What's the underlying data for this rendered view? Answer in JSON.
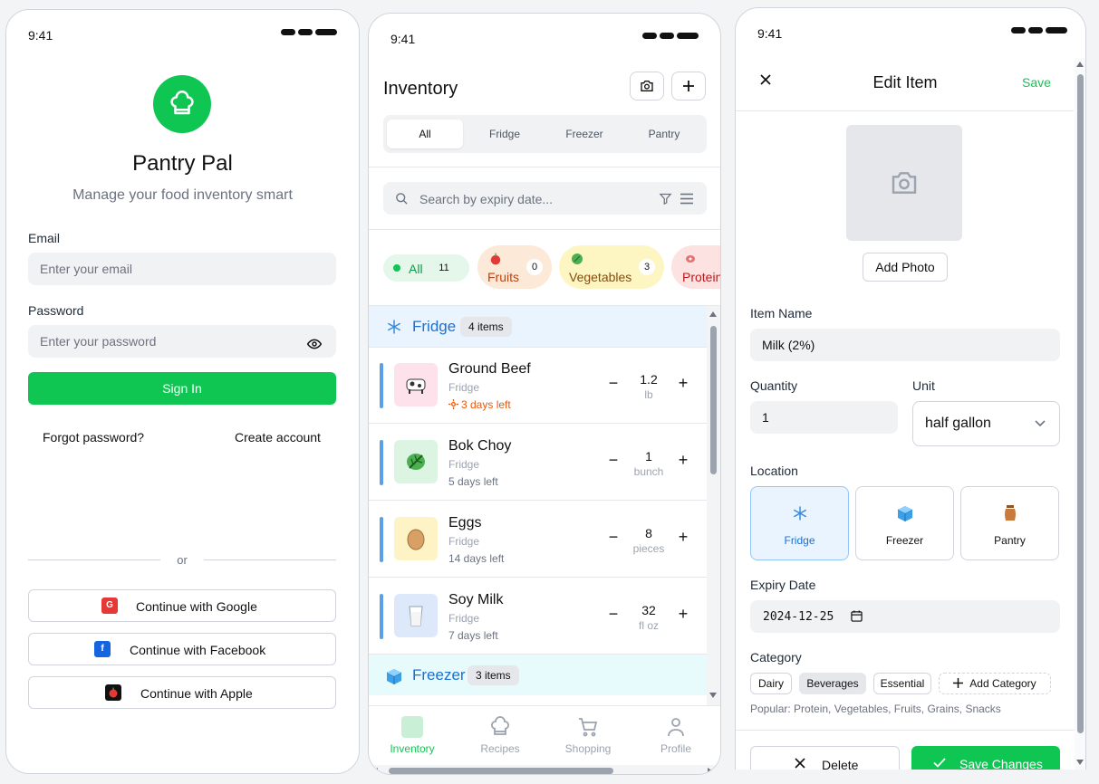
{
  "login": {
    "time": "9:41",
    "app_name": "Pantry Pal",
    "tagline": "Manage your food inventory smart",
    "email_label": "Email",
    "email_placeholder": "Enter your email",
    "password_label": "Password",
    "password_placeholder": "Enter your password",
    "signin_label": "Sign In",
    "forgot_label": "Forgot password?",
    "create_label": "Create account",
    "or_label": "or",
    "google_label": "Continue with Google",
    "google_icon_text": "G",
    "facebook_label": "Continue with Facebook",
    "facebook_icon_text": "f",
    "apple_label": "Continue with Apple",
    "brand_color": "#10c653"
  },
  "inventory": {
    "time": "9:41",
    "title": "Inventory",
    "tabs": [
      "All",
      "Fridge",
      "Freezer",
      "Pantry"
    ],
    "active_tab": "All",
    "search_placeholder": "Search by expiry date...",
    "filters": [
      {
        "label": "All",
        "count": "11"
      },
      {
        "label": "Fruits",
        "count": "0"
      },
      {
        "label": "Vegetables",
        "count": "3"
      },
      {
        "label": "Protein"
      }
    ],
    "sections": [
      {
        "title": "Fridge",
        "badge": "4 items"
      },
      {
        "title": "Freezer",
        "badge": "3 items"
      }
    ],
    "items": [
      {
        "name": "Ground Beef",
        "location": "Fridge",
        "expiry": "3 days left",
        "qty": "1.2",
        "unit": "lb",
        "icon": "cow-icon"
      },
      {
        "name": "Bok Choy",
        "location": "Fridge",
        "expiry": "5 days left",
        "qty": "1",
        "unit": "bunch",
        "icon": "leafy-green-icon"
      },
      {
        "name": "Eggs",
        "location": "Fridge",
        "expiry": "14 days left",
        "qty": "8",
        "unit": "pieces",
        "icon": "egg-icon"
      },
      {
        "name": "Soy Milk",
        "location": "Fridge",
        "expiry": "7 days left",
        "qty": "32",
        "unit": "fl oz",
        "icon": "milk-glass-icon"
      }
    ],
    "nav": [
      "Inventory",
      "Recipes",
      "Shopping",
      "Profile"
    ],
    "active_nav": "Inventory"
  },
  "edit": {
    "time": "9:41",
    "title": "Edit Item",
    "save_label": "Save",
    "add_photo_label": "Add Photo",
    "item_name_label": "Item Name",
    "item_name_value": "Milk (2%)",
    "quantity_label": "Quantity",
    "quantity_value": "1",
    "unit_label": "Unit",
    "unit_value": "half gallon",
    "location_label": "Location",
    "locations": [
      "Fridge",
      "Freezer",
      "Pantry"
    ],
    "selected_location": "Fridge",
    "expiry_label": "Expiry Date",
    "expiry_value": "2024-12-25",
    "category_label": "Category",
    "categories": [
      "Dairy",
      "Beverages",
      "Essential"
    ],
    "selected_category": "Beverages",
    "add_category_label": "Add Category",
    "popular_text": "Popular: Protein, Vegetables, Fruits, Grains, Snacks",
    "delete_label": "Delete",
    "save_changes_label": "Save Changes"
  }
}
